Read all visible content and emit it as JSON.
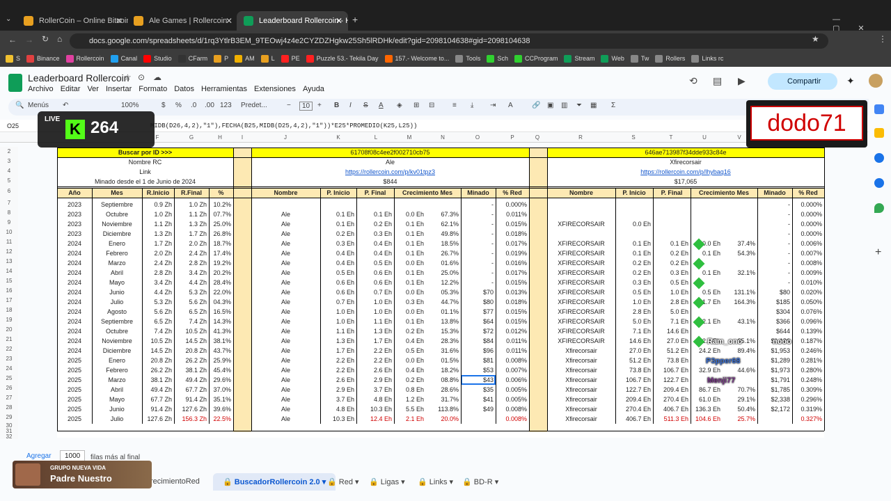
{
  "browser": {
    "tabs": [
      {
        "title": "RollerCoin – Online Bitcoin Min",
        "color": "#e8a020"
      },
      {
        "title": "Ale Games | Rollercoin",
        "color": "#e8a020"
      },
      {
        "title": "Leaderboard Rollercoin - Hoja",
        "color": "#0f9d58"
      }
    ],
    "url": "docs.google.com/spreadsheets/d/1rq3YtlrB3EM_9TEOwj4z4e2CYZDZHgkw25Sh5lRDHk/edit?gid=2098104638#gid=2098104638",
    "bookmarks": [
      "S",
      "Binance",
      "Rollercoin",
      "Canal",
      "Studio",
      "CFarm",
      "P",
      "AM",
      "L",
      "PE",
      "Puzzle 53.- Tekila Day",
      "157.- Welcome to...",
      "Tools",
      "Sch",
      "CCProgram",
      "Stream",
      "Web",
      "Tw",
      "Rollers",
      "Links rc"
    ]
  },
  "doc": {
    "title": "Leaderboard Rollercoin",
    "menus": [
      "Archivo",
      "Editar",
      "Ver",
      "Insertar",
      "Formato",
      "Datos",
      "Herramientas",
      "Extensiones",
      "Ayuda"
    ],
    "share": "Compartir",
    "toolbar": {
      "menus": "Menús",
      "zoom": "100%",
      "currency": "$",
      "percent": "%",
      "dec_less": ".0",
      "dec_more": ".00",
      "numfmt": "123",
      "font": "Predet...",
      "size": "10"
    },
    "cellref": "O25",
    "formula": "MIDB(D26,4,2),\"1\"),FECHA(B25,MIDB(D25,4,2),\"1\"))*E25*PROMEDIO(K25,L25))"
  },
  "columns": [
    "F",
    "G",
    "H",
    "I",
    "J",
    "K",
    "L",
    "M",
    "N",
    "O",
    "P",
    "Q",
    "R",
    "S",
    "T",
    "U",
    "V",
    "W",
    "X",
    "Y"
  ],
  "rows": [
    "2",
    "3",
    "4",
    "5",
    "6",
    "7",
    "8",
    "9",
    "10",
    "11",
    "12",
    "13",
    "14",
    "15",
    "16",
    "17",
    "18",
    "19",
    "20",
    "21",
    "22",
    "23",
    "24",
    "25",
    "26",
    "27",
    "28",
    "29",
    "30",
    "31",
    "32"
  ],
  "left_block": {
    "search_label": "Buscar por ID >>>",
    "nombre_rc": "Nombre RC",
    "link": "Link",
    "minado": "Minado desde el 1 de Junio de 2024",
    "headers": [
      "Año",
      "Mes",
      "R.Inicio",
      "R.Final",
      "%"
    ],
    "data": [
      [
        "2023",
        "Septiembre",
        "0.9 Zh",
        "1.0 Zh",
        "10.2%"
      ],
      [
        "2023",
        "Octubre",
        "1.0 Zh",
        "1.1 Zh",
        "07.7%"
      ],
      [
        "2023",
        "Noviembre",
        "1.1 Zh",
        "1.3 Zh",
        "25.0%"
      ],
      [
        "2023",
        "Diciembre",
        "1.3 Zh",
        "1.7 Zh",
        "26.8%"
      ],
      [
        "2024",
        "Enero",
        "1.7 Zh",
        "2.0 Zh",
        "18.7%"
      ],
      [
        "2024",
        "Febrero",
        "2.0 Zh",
        "2.4 Zh",
        "17.4%"
      ],
      [
        "2024",
        "Marzo",
        "2.4 Zh",
        "2.8 Zh",
        "19.2%"
      ],
      [
        "2024",
        "Abril",
        "2.8 Zh",
        "3.4 Zh",
        "20.2%"
      ],
      [
        "2024",
        "Mayo",
        "3.4 Zh",
        "4.4 Zh",
        "28.4%"
      ],
      [
        "2024",
        "Junio",
        "4.4 Zh",
        "5.3 Zh",
        "22.0%"
      ],
      [
        "2024",
        "Julio",
        "5.3 Zh",
        "5.6 Zh",
        "04.3%"
      ],
      [
        "2024",
        "Agosto",
        "5.6 Zh",
        "6.5 Zh",
        "16.5%"
      ],
      [
        "2024",
        "Septiembre",
        "6.5 Zh",
        "7.4 Zh",
        "14.3%"
      ],
      [
        "2024",
        "Octubre",
        "7.4 Zh",
        "10.5 Zh",
        "41.3%"
      ],
      [
        "2024",
        "Noviembre",
        "10.5 Zh",
        "14.5 Zh",
        "38.1%"
      ],
      [
        "2024",
        "Diciembre",
        "14.5 Zh",
        "20.8 Zh",
        "43.7%"
      ],
      [
        "2025",
        "Enero",
        "20.8 Zh",
        "26.2 Zh",
        "25.9%"
      ],
      [
        "2025",
        "Febrero",
        "26.2 Zh",
        "38.1 Zh",
        "45.4%"
      ],
      [
        "2025",
        "Marzo",
        "38.1 Zh",
        "49.4 Zh",
        "29.6%"
      ],
      [
        "2025",
        "Abril",
        "49.4 Zh",
        "67.7 Zh",
        "37.0%"
      ],
      [
        "2025",
        "Mayo",
        "67.7 Zh",
        "91.4 Zh",
        "35.1%"
      ],
      [
        "2025",
        "Junio",
        "91.4 Zh",
        "127.6 Zh",
        "39.6%"
      ],
      [
        "2025",
        "Julio",
        "127.6 Zh",
        "156.3 Zh",
        "22.5%"
      ]
    ]
  },
  "mid_block": {
    "id": "61708f08c4ee2f002710cb75",
    "name": "Ale",
    "link": "https://rollercoin.com/p/kv01tpz3",
    "value": "$844",
    "headers": [
      "Nombre",
      "P. Inicio",
      "P. Final",
      "Crecimiento Mes",
      "Minado",
      "% Red"
    ],
    "data": [
      [
        "",
        "",
        "",
        "",
        "",
        "-",
        "0.000%"
      ],
      [
        "Ale",
        "0.1 Eh",
        "0.1 Eh",
        "0.0 Eh",
        "67.3%",
        "-",
        "0.011%"
      ],
      [
        "Ale",
        "0.1 Eh",
        "0.2 Eh",
        "0.1 Eh",
        "62.1%",
        "-",
        "0.015%"
      ],
      [
        "Ale",
        "0.2 Eh",
        "0.3 Eh",
        "0.1 Eh",
        "49.8%",
        "-",
        "0.018%"
      ],
      [
        "Ale",
        "0.3 Eh",
        "0.4 Eh",
        "0.1 Eh",
        "18.5%",
        "-",
        "0.017%"
      ],
      [
        "Ale",
        "0.4 Eh",
        "0.4 Eh",
        "0.1 Eh",
        "26.7%",
        "-",
        "0.019%"
      ],
      [
        "Ale",
        "0.4 Eh",
        "0.5 Eh",
        "0.0 Eh",
        "01.6%",
        "-",
        "0.016%"
      ],
      [
        "Ale",
        "0.5 Eh",
        "0.6 Eh",
        "0.1 Eh",
        "25.0%",
        "-",
        "0.017%"
      ],
      [
        "Ale",
        "0.6 Eh",
        "0.6 Eh",
        "0.1 Eh",
        "12.2%",
        "-",
        "0.015%"
      ],
      [
        "Ale",
        "0.6 Eh",
        "0.7 Eh",
        "0.0 Eh",
        "05.3%",
        "$70",
        "0.013%"
      ],
      [
        "Ale",
        "0.7 Eh",
        "1.0 Eh",
        "0.3 Eh",
        "44.7%",
        "$80",
        "0.018%"
      ],
      [
        "Ale",
        "1.0 Eh",
        "1.0 Eh",
        "0.0 Eh",
        "01.1%",
        "$77",
        "0.015%"
      ],
      [
        "Ale",
        "1.0 Eh",
        "1.1 Eh",
        "0.1 Eh",
        "13.8%",
        "$64",
        "0.015%"
      ],
      [
        "Ale",
        "1.1 Eh",
        "1.3 Eh",
        "0.2 Eh",
        "15.3%",
        "$72",
        "0.012%"
      ],
      [
        "Ale",
        "1.3 Eh",
        "1.7 Eh",
        "0.4 Eh",
        "28.3%",
        "$84",
        "0.011%"
      ],
      [
        "Ale",
        "1.7 Eh",
        "2.2 Eh",
        "0.5 Eh",
        "31.6%",
        "$96",
        "0.011%"
      ],
      [
        "Ale",
        "2.2 Eh",
        "2.2 Eh",
        "0.0 Eh",
        "01.5%",
        "$81",
        "0.008%"
      ],
      [
        "Ale",
        "2.2 Eh",
        "2.6 Eh",
        "0.4 Eh",
        "18.2%",
        "$53",
        "0.007%"
      ],
      [
        "Ale",
        "2.6 Eh",
        "2.9 Eh",
        "0.2 Eh",
        "08.8%",
        "$43",
        "0.006%"
      ],
      [
        "Ale",
        "2.9 Eh",
        "3.7 Eh",
        "0.8 Eh",
        "28.6%",
        "$35",
        "0.005%"
      ],
      [
        "Ale",
        "3.7 Eh",
        "4.8 Eh",
        "1.2 Eh",
        "31.7%",
        "$41",
        "0.005%"
      ],
      [
        "Ale",
        "4.8 Eh",
        "10.3 Eh",
        "5.5 Eh",
        "113.8%",
        "$49",
        "0.008%"
      ],
      [
        "Ale",
        "10.3 Eh",
        "12.4 Eh",
        "2.1 Eh",
        "20.0%",
        "",
        "0.008%"
      ]
    ]
  },
  "right_block": {
    "id": "646ae713987f34dde933c84e",
    "name": "Xfirecorsair",
    "link": "https://rollercoin.com/p/lhybaq16",
    "value": "$17,065",
    "headers": [
      "Nombre",
      "P. Inicio",
      "P. Final",
      "Crecimiento Mes",
      "Minado",
      "% Red"
    ],
    "data": [
      [
        "",
        "",
        "",
        "",
        "",
        "-",
        "0.000%"
      ],
      [
        "",
        "",
        "",
        "",
        "",
        "-",
        "0.000%"
      ],
      [
        "XFIRECORSAIR",
        "0.0 Eh",
        "",
        "",
        "",
        "-",
        "0.000%"
      ],
      [
        "",
        "",
        "",
        "",
        "",
        "-",
        "0.000%"
      ],
      [
        "XFIRECORSAIR",
        "0.1 Eh",
        "0.1 Eh",
        "0.0 Eh",
        "37.4%",
        "-",
        "0.006%"
      ],
      [
        "XFIRECORSAIR",
        "0.1 Eh",
        "0.2 Eh",
        "0.1 Eh",
        "54.3%",
        "-",
        "0.007%"
      ],
      [
        "XFIRECORSAIR",
        "0.2 Eh",
        "0.2 Eh",
        "",
        "",
        "-",
        "0.008%"
      ],
      [
        "XFIRECORSAIR",
        "0.2 Eh",
        "0.3 Eh",
        "0.1 Eh",
        "32.1%",
        "-",
        "0.009%"
      ],
      [
        "XFIRECORSAIR",
        "0.3 Eh",
        "0.5 Eh",
        "",
        "",
        "-",
        "0.010%"
      ],
      [
        "XFIRECORSAIR",
        "0.5 Eh",
        "1.0 Eh",
        "0.5 Eh",
        "131.1%",
        "$80",
        "0.020%"
      ],
      [
        "XFIRECORSAIR",
        "1.0 Eh",
        "2.8 Eh",
        "1.7 Eh",
        "164.3%",
        "$185",
        "0.050%"
      ],
      [
        "XFIRECORSAIR",
        "2.8 Eh",
        "5.0 Eh",
        "",
        "",
        "$304",
        "0.076%"
      ],
      [
        "XFIRECORSAIR",
        "5.0 Eh",
        "7.1 Eh",
        "2.1 Eh",
        "43.1%",
        "$366",
        "0.096%"
      ],
      [
        "XFIRECORSAIR",
        "7.1 Eh",
        "14.6 Eh",
        "",
        "",
        "$644",
        "0.139%"
      ],
      [
        "XFIRECORSAIR",
        "14.6 Eh",
        "27.0 Eh",
        "12.4 Eh",
        "85.1%",
        "$1,186",
        "0.187%"
      ],
      [
        "Xfirecorsair",
        "27.0 Eh",
        "51.2 Eh",
        "24.2 Eh",
        "89.4%",
        "$1,953",
        "0.246%"
      ],
      [
        "Xfirecorsair",
        "51.2 Eh",
        "73.8 Eh",
        "",
        "",
        "$1,289",
        "0.281%"
      ],
      [
        "Xfirecorsair",
        "73.8 Eh",
        "106.7 Eh",
        "32.9 Eh",
        "44.6%",
        "$1,973",
        "0.280%"
      ],
      [
        "Xfirecorsair",
        "106.7 Eh",
        "122.7 Eh",
        "",
        "",
        "$1,791",
        "0.248%"
      ],
      [
        "Xfirecorsair",
        "122.7 Eh",
        "209.4 Eh",
        "86.7 Eh",
        "70.7%",
        "$1,785",
        "0.309%"
      ],
      [
        "Xfirecorsair",
        "209.4 Eh",
        "270.4 Eh",
        "61.0 Eh",
        "29.1%",
        "$2,338",
        "0.296%"
      ],
      [
        "Xfirecorsair",
        "270.4 Eh",
        "406.7 Eh",
        "136.3 Eh",
        "50.4%",
        "$2,172",
        "0.319%"
      ],
      [
        "Xfirecorsair",
        "406.7 Eh",
        "511.3 Eh",
        "104.6 Eh",
        "25.7%",
        "",
        "0.327%"
      ]
    ]
  },
  "chat_names": [
    "Ram_ono",
    "P3pper68",
    "Menji77",
    "nooo"
  ],
  "bottom": {
    "add": "Agregar",
    "rows_count": "1000",
    "rows_text": "filas más al final"
  },
  "sheets": [
    "recimientoRed",
    "BuscadorRollercoin 2.0",
    "Red",
    "Ligas",
    "Links",
    "BD-R"
  ],
  "overlay": {
    "live": "LIVE",
    "viewers": "264",
    "streamer": "dodo71",
    "group": "GRUPO NUEVA VIDA",
    "prayer": "Padre Nuestro"
  }
}
